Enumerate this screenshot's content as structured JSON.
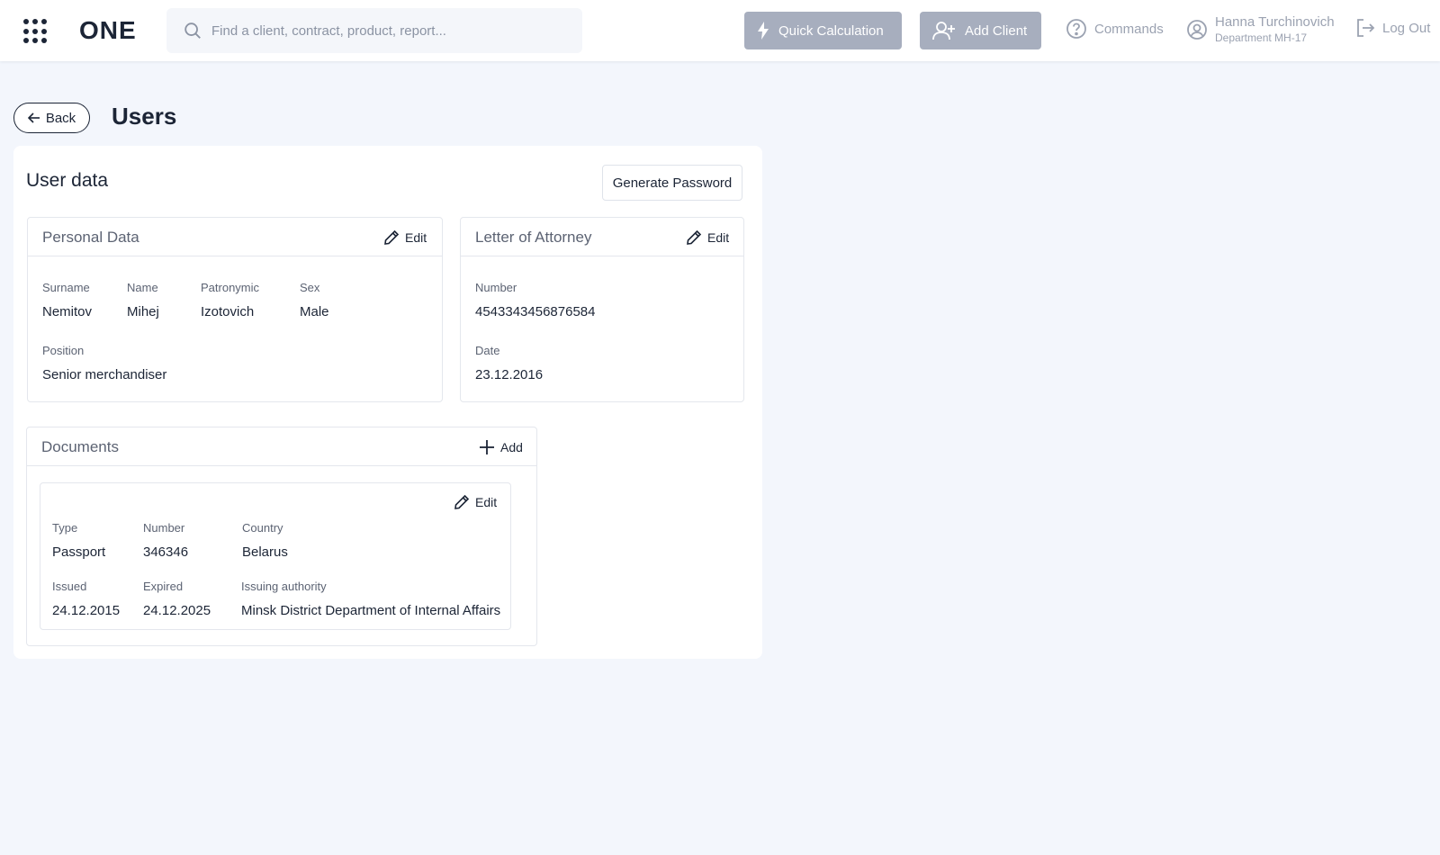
{
  "header": {
    "logo": "ONE",
    "search_placeholder": "Find a client, contract, product, report...",
    "quick_calculation": "Quick Calculation",
    "add_client": "Add Client",
    "commands": "Commands",
    "user_name": "Hanna Turchinovich",
    "user_department": "Department MH-17",
    "logout": "Log Out",
    "button_color": "#a7aebe"
  },
  "page": {
    "back": "Back",
    "title": "Users"
  },
  "user_data": {
    "title": "User data",
    "generate_password": "Generate Password",
    "personal": {
      "title": "Personal Data",
      "edit": "Edit",
      "surname_label": "Surname",
      "surname": "Nemitov",
      "name_label": "Name",
      "name": "Mihej",
      "patronymic_label": "Patronymic",
      "patronymic": "Izotovich",
      "sex_label": "Sex",
      "sex": "Male",
      "position_label": "Position",
      "position": "Senior merchandiser"
    },
    "attorney": {
      "title": "Letter of Attorney",
      "edit": "Edit",
      "number_label": "Number",
      "number": "4543343456876584",
      "date_label": "Date",
      "date": "23.12.2016"
    },
    "documents": {
      "title": "Documents",
      "add": "Add",
      "edit": "Edit",
      "type_label": "Type",
      "type": "Passport",
      "number_label": "Number",
      "number": "346346",
      "country_label": "Country",
      "country": "Belarus",
      "issued_label": "Issued",
      "issued": "24.12.2015",
      "expired_label": "Expired",
      "expired": "24.12.2025",
      "authority_label": "Issuing authority",
      "authority": "Minsk District Department of Internal Affairs"
    }
  }
}
